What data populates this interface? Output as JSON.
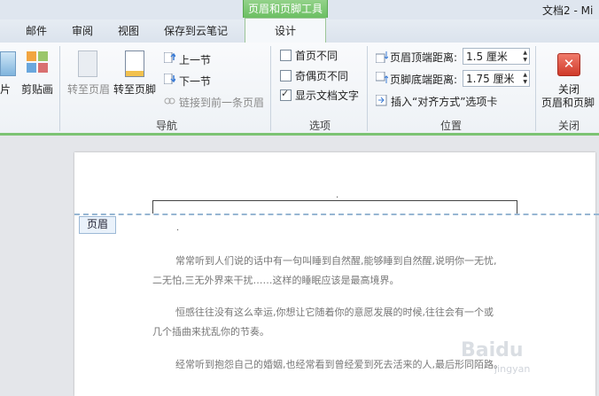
{
  "window": {
    "context_group": "页眉和页脚工具",
    "doc_title": "文档2 - Mi"
  },
  "tabs": {
    "mail": "邮件",
    "review": "审阅",
    "view": "视图",
    "save_cloud": "保存到云笔记",
    "design": "设计"
  },
  "ribbon": {
    "insert": {
      "picture_partial": "片",
      "clipart": "剪贴画"
    },
    "nav": {
      "goto_header": "转至页眉",
      "goto_footer": "转至页脚",
      "prev": "上一节",
      "next": "下一节",
      "link_prev": "链接到前一条页眉",
      "label": "导航"
    },
    "options": {
      "diff_first": "首页不同",
      "diff_odd_even": "奇偶页不同",
      "show_doc_text": "显示文档文字",
      "diff_first_checked": false,
      "diff_odd_even_checked": false,
      "show_doc_text_checked": true,
      "label": "选项"
    },
    "position": {
      "header_top_label": "页眉顶端距离:",
      "header_top_value": "1.5 厘米",
      "footer_bottom_label": "页脚底端距离:",
      "footer_bottom_value": "1.75 厘米",
      "insert_align_tab": "插入“对齐方式”选项卡",
      "label": "位置"
    },
    "close": {
      "line1": "关闭",
      "line2": "页眉和页脚",
      "label": "关闭"
    }
  },
  "document": {
    "header_tag": "页眉",
    "paragraphs": [
      {
        "line1": "常常听到人们说的话中有一句叫睡到自然醒,能够睡到自然醒,说明你一无忧,",
        "line2": "二无怕,三无外界来干扰……这样的睡眠应该是最高境界。"
      },
      {
        "line1": "恒感往往没有这么幸运,你想让它随着你的意愿发展的时候,往往会有一个或",
        "line2": "几个插曲来扰乱你的节奏。"
      },
      {
        "line1": "经常听到抱怨自己的婚姻,也经常看到曾经爱到死去活来的人,最后形同陌路。"
      }
    ]
  },
  "watermark": {
    "brand": "Baidu",
    "sub": "jingyan"
  },
  "colors": {
    "context_green": "#6bbf62",
    "close_red": "#cf3a2a",
    "header_dash": "#97b6d3"
  }
}
